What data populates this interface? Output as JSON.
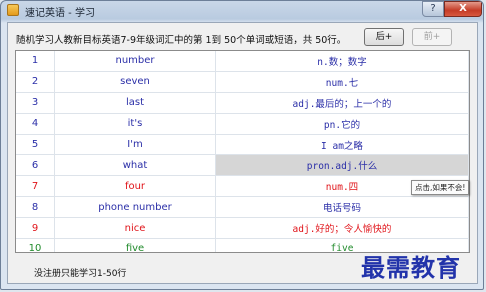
{
  "window": {
    "title": "速记英语 - 学习",
    "help_button": "?",
    "close_button": "X"
  },
  "header": {
    "text": "随机学习人教新目标英语7-9年级词汇中的第 1到 50个单词或短语，共 50行。",
    "next_button": "后+",
    "prev_button": "前+"
  },
  "words": [
    {
      "num": "1",
      "word": "number",
      "meaning": "n.数；数字",
      "color": "blue"
    },
    {
      "num": "2",
      "word": "seven",
      "meaning": "num.七",
      "color": "blue"
    },
    {
      "num": "3",
      "word": "last",
      "meaning": "adj.最后的；上一个的",
      "color": "blue"
    },
    {
      "num": "4",
      "word": "it's",
      "meaning": "pn.它的",
      "color": "blue"
    },
    {
      "num": "5",
      "word": "I'm",
      "meaning": "I am之略",
      "color": "blue"
    },
    {
      "num": "6",
      "word": "what",
      "meaning": "pron.adj.什么",
      "color": "blue",
      "selected": true
    },
    {
      "num": "7",
      "word": "four",
      "meaning": "num.四",
      "color": "red"
    },
    {
      "num": "8",
      "word": "phone number",
      "meaning": "电话号码",
      "color": "blue"
    },
    {
      "num": "9",
      "word": "nice",
      "meaning": "adj.好的；令人愉快的",
      "color": "red"
    },
    {
      "num": "10",
      "word": "five",
      "meaning": "five",
      "color": "green"
    }
  ],
  "tooltip": "点击,如果不会!",
  "footer": {
    "text": "没注册只能学习1-50行"
  },
  "watermark": "最需教育"
}
